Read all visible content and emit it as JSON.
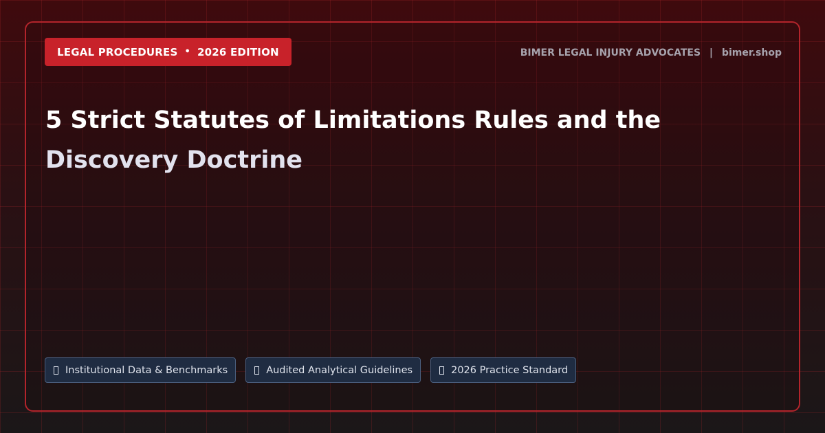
{
  "header": {
    "badge": {
      "category": "LEGAL PROCEDURES",
      "separator": "•",
      "edition": "2026 EDITION"
    },
    "brand": {
      "name": "BIMER LEGAL INJURY ADVOCATES",
      "separator": "|",
      "domain": "bimer.shop"
    }
  },
  "title": {
    "line1": "5 Strict Statutes of Limitations Rules and the",
    "line2": "Discovery Doctrine"
  },
  "chips": [
    {
      "icon": "missing-glyph-icon",
      "label": "Institutional Data & Benchmarks"
    },
    {
      "icon": "missing-glyph-icon",
      "label": "Audited Analytical Guidelines"
    },
    {
      "icon": "missing-glyph-icon",
      "label": "2026 Practice Standard"
    }
  ],
  "colors": {
    "accent": "#c8222a",
    "frame_border": "#b3242b",
    "chip_background": "#1f2c42",
    "chip_border": "#4a5e7e",
    "brand_text": "#a7a3ad"
  }
}
